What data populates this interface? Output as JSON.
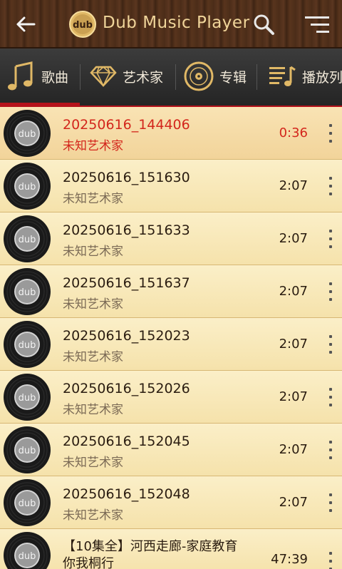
{
  "header": {
    "title": "Dub Music Player",
    "logo_text": "dub",
    "back_icon": "arrow-left-icon",
    "search_icon": "search-icon",
    "menu_icon": "menu-icon"
  },
  "tabs": [
    {
      "label": "歌曲",
      "icon": "music-note-icon",
      "selected": true
    },
    {
      "label": "艺术家",
      "icon": "diamond-icon",
      "selected": false
    },
    {
      "label": "专辑",
      "icon": "disc-icon",
      "selected": false
    },
    {
      "label": "播放列",
      "icon": "playlist-icon",
      "selected": false
    }
  ],
  "colors": {
    "accent": "#b5121b",
    "active_text": "#d3261c",
    "title_gold": "#f0d59a"
  },
  "songs": [
    {
      "title": "20250616_144406",
      "artist": "未知艺术家",
      "duration": "0:36",
      "playing": true
    },
    {
      "title": "20250616_151630",
      "artist": "未知艺术家",
      "duration": "2:07",
      "playing": false
    },
    {
      "title": "20250616_151633",
      "artist": "未知艺术家",
      "duration": "2:07",
      "playing": false
    },
    {
      "title": "20250616_151637",
      "artist": "未知艺术家",
      "duration": "2:07",
      "playing": false
    },
    {
      "title": "20250616_152023",
      "artist": "未知艺术家",
      "duration": "2:07",
      "playing": false
    },
    {
      "title": "20250616_152026",
      "artist": "未知艺术家",
      "duration": "2:07",
      "playing": false
    },
    {
      "title": "20250616_152045",
      "artist": "未知艺术家",
      "duration": "2:07",
      "playing": false
    },
    {
      "title": "20250616_152048",
      "artist": "未知艺术家",
      "duration": "2:07",
      "playing": false
    },
    {
      "title": "【10集全】河西走廊-家庭教育",
      "artist": "你我桐行",
      "duration": "47:39",
      "playing": false
    }
  ],
  "disc_label": "dub"
}
